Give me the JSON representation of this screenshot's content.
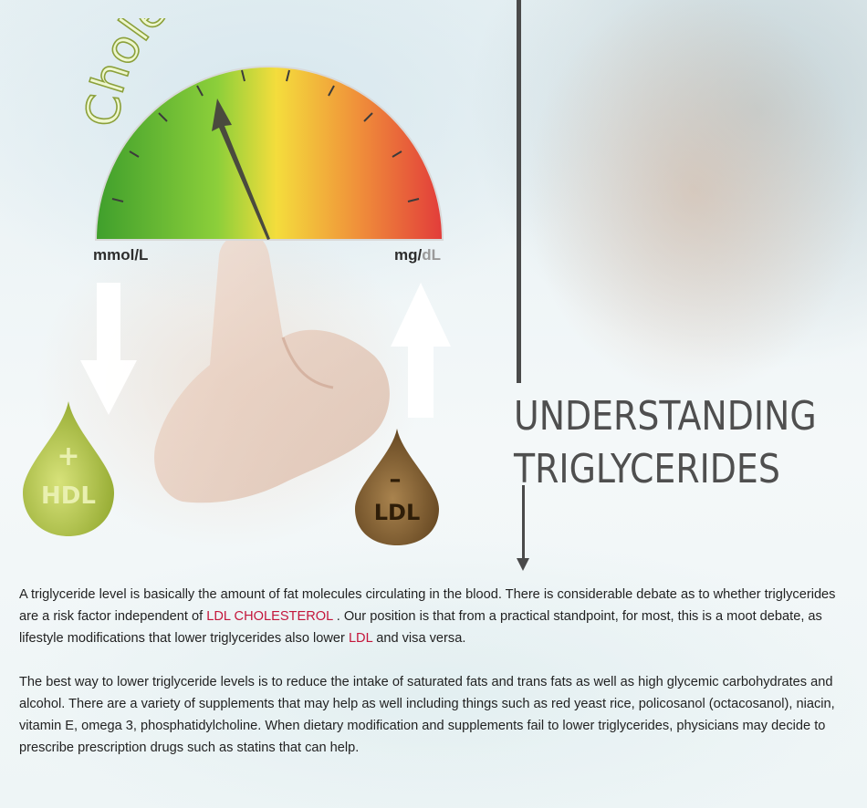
{
  "gauge": {
    "title": "Cholesterol",
    "unit_left": "mmol/L",
    "unit_right_main": "mg/",
    "unit_right_faded": "dL"
  },
  "drops": {
    "hdl_label": "HDL",
    "hdl_sign": "+",
    "ldl_label": "LDL",
    "ldl_sign": "–"
  },
  "heading": {
    "line1": "UNDERSTANDING",
    "line2": "TRIGLYCERIDES"
  },
  "paragraphs": {
    "p1_part1": "A triglyceride level is basically the amount of fat molecules circulating in the blood. There is considerable debate as to whether triglycerides are a risk factor independent of ",
    "p1_link1": "LDL CHOLESTEROL",
    "p1_part2": " . Our position is that from a practical standpoint, for most, this is a moot debate, as lifestyle modifications that lower triglycerides also lower ",
    "p1_link2": "LDL",
    "p1_part3": " and visa versa.",
    "p2": "The best way to lower triglyceride levels is to reduce the intake of saturated fats and trans fats as well as high glycemic carbohydrates and alcohol. There are a variety of supplements that may help as well including things such as red yeast rice, policosanol (octacosanol), niacin, vitamin E, omega 3, phosphatidylcholine. When dietary modification and supplements fail to lower triglycerides, physicians may decide to prescribe prescription drugs such as statins that can help."
  },
  "colors": {
    "gauge_green": "#58b531",
    "gauge_yellow": "#f2d23a",
    "gauge_red": "#e8493d",
    "link": "#c4163b",
    "heading": "#4f4f4f",
    "hdl_drop": "#a9be3a",
    "ldl_drop": "#6b4a22"
  }
}
